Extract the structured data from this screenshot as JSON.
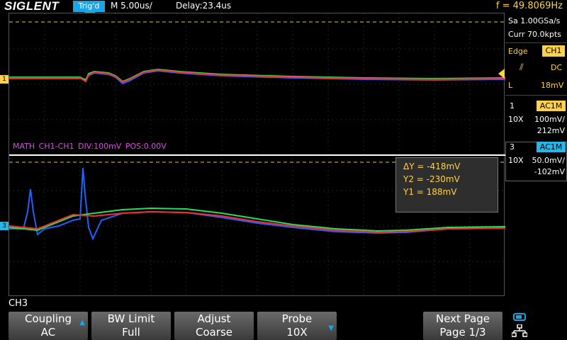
{
  "header": {
    "brand": "SIGLENT",
    "trigger_status": "Trig'd",
    "timebase": "M 5.00us/",
    "delay": "Delay:23.4us",
    "frequency": "f = 49.8069Hz"
  },
  "acquisition": {
    "sample_rate": "Sa 1.00GSa/s",
    "memory": "Curr 70.0kpts"
  },
  "trigger": {
    "type": "Edge",
    "source": "CH1",
    "slope_icon": "rising-edge-icon",
    "coupling": "DC",
    "level_label": "L",
    "level": "18mV"
  },
  "channels": [
    {
      "number": "1",
      "coupling": "AC1M",
      "probe": "10X",
      "scale": "100mV/",
      "offset": "212mV",
      "color": "#ffd24a"
    },
    {
      "number": "3",
      "coupling": "AC1M",
      "probe": "10X",
      "scale": "50.0mV/",
      "offset": "-102mV",
      "color": "#27b6e8"
    }
  ],
  "math": {
    "label": "MATH",
    "function": "CH1-CH1",
    "div": "DIV:100mV",
    "pos": "POS:0.00V",
    "color": "#d84de0"
  },
  "cursors": {
    "delta_y": "ΔY = -418mV",
    "y2": "Y2 = -230mV",
    "y1": "Y1 = 188mV"
  },
  "menu": {
    "title": "CH3",
    "keys": [
      {
        "label": "Coupling",
        "value": "AC"
      },
      {
        "label": "BW Limit",
        "value": "Full"
      },
      {
        "label": "Adjust",
        "value": "Coarse"
      },
      {
        "label": "Probe",
        "value": "10X"
      },
      {
        "label": "Next Page",
        "value": "Page 1/3"
      }
    ]
  },
  "status_icons": [
    "usb-icon",
    "lan-icon"
  ]
}
